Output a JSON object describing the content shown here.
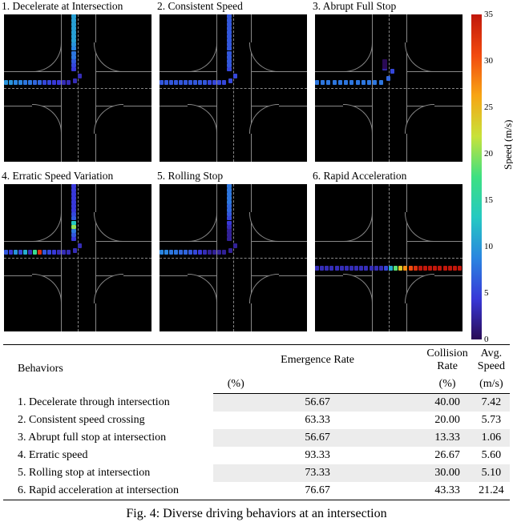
{
  "caption": "Fig. 4: Diverse driving behaviors at an intersection",
  "colorbar": {
    "label": "Speed (m/s)",
    "min": 0,
    "max": 35,
    "ticks": [
      0,
      5,
      10,
      15,
      20,
      25,
      30,
      35
    ]
  },
  "panels": [
    {
      "title": "1. Decelerate at Intersection"
    },
    {
      "title": "2. Consistent Speed"
    },
    {
      "title": "3. Abrupt Full Stop"
    },
    {
      "title": "4. Erratic Speed Variation"
    },
    {
      "title": "5. Rolling Stop"
    },
    {
      "title": "6. Rapid Acceleration"
    }
  ],
  "chart_data": [
    {
      "type": "heatmap",
      "title": "1. Decelerate at Intersection",
      "trajectory": "left-to-up",
      "speeds": [
        10,
        10,
        9,
        9,
        8,
        8,
        7,
        7,
        5,
        5,
        4,
        4,
        3,
        3,
        3,
        3,
        4,
        5,
        6,
        8,
        8,
        9,
        10,
        11,
        11,
        11,
        11,
        11,
        11,
        11
      ]
    },
    {
      "type": "heatmap",
      "title": "2. Consistent Speed",
      "trajectory": "left-to-up",
      "speeds": [
        6,
        6,
        6,
        6,
        6,
        6,
        6,
        6,
        6,
        6,
        5,
        5,
        5,
        5,
        5,
        5,
        5,
        6,
        6,
        6,
        6,
        6,
        6,
        6,
        6,
        6,
        6,
        6,
        6,
        6
      ]
    },
    {
      "type": "heatmap",
      "title": "3. Abrupt Full Stop",
      "trajectory": "left-to-up-stop",
      "speeds": [
        8,
        8,
        8,
        8,
        8,
        8,
        8,
        8,
        8,
        8,
        8,
        8,
        7,
        5,
        3,
        2,
        1,
        0,
        0,
        0,
        0,
        0,
        0,
        0,
        0
      ]
    },
    {
      "type": "heatmap",
      "title": "4. Erratic Speed Variation",
      "trajectory": "left-to-up",
      "speeds": [
        6,
        4,
        10,
        5,
        12,
        3,
        18,
        34,
        6,
        5,
        4,
        3,
        3,
        3,
        3,
        3,
        4,
        6,
        8,
        22,
        14,
        6,
        5,
        4,
        4,
        4,
        4,
        4,
        4,
        4
      ]
    },
    {
      "type": "heatmap",
      "title": "5. Rolling Stop",
      "trajectory": "left-to-up",
      "speeds": [
        9,
        9,
        8,
        8,
        7,
        7,
        6,
        5,
        4,
        3,
        2,
        2,
        2,
        2,
        2,
        2,
        2,
        2,
        2,
        3,
        4,
        5,
        6,
        7,
        7,
        8,
        8,
        8,
        8,
        8
      ]
    },
    {
      "type": "heatmap",
      "title": "6. Rapid Acceleration",
      "trajectory": "left-to-right",
      "speeds": [
        3,
        3,
        3,
        3,
        3,
        3,
        3,
        3,
        3,
        3,
        3,
        3,
        3,
        3,
        5,
        12,
        20,
        26,
        30,
        33,
        34,
        35,
        35,
        35,
        35,
        35,
        35,
        35,
        35,
        35
      ]
    }
  ],
  "table": {
    "headers": {
      "behaviors": "Behaviors",
      "emergence": "Emergence Rate",
      "emergence_u": "(%)",
      "collision": "Collision Rate",
      "collision_u": "(%)",
      "avgspeed": "Avg. Speed",
      "avgspeed_u": "(m/s)"
    },
    "rows": [
      {
        "behavior": "1. Decelerate through intersection",
        "emergence": "56.67",
        "collision": "40.00",
        "speed": "7.42"
      },
      {
        "behavior": "2. Consistent speed crossing",
        "emergence": "63.33",
        "collision": "20.00",
        "speed": "5.73"
      },
      {
        "behavior": "3. Abrupt full stop at intersection",
        "emergence": "56.67",
        "collision": "13.33",
        "speed": "1.06"
      },
      {
        "behavior": "4. Erratic speed",
        "emergence": "93.33",
        "collision": "26.67",
        "speed": "5.60"
      },
      {
        "behavior": "5. Rolling stop at intersection",
        "emergence": "73.33",
        "collision": "30.00",
        "speed": "5.10"
      },
      {
        "behavior": "6. Rapid acceleration at intersection",
        "emergence": "76.67",
        "collision": "43.33",
        "speed": "21.24"
      }
    ]
  }
}
